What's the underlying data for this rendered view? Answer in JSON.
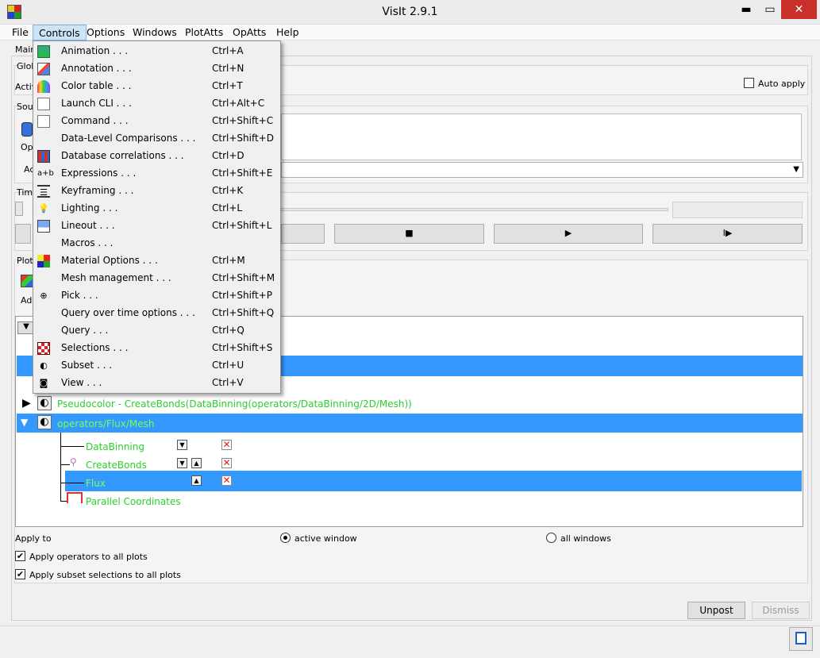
{
  "window": {
    "title": "VisIt 2.9.1",
    "minimize": "▬",
    "maximize": "▭",
    "close": "✕"
  },
  "menubar": [
    "File",
    "Controls",
    "Options",
    "Windows",
    "PlotAtts",
    "OpAtts",
    "Help"
  ],
  "tabs": {
    "main": "Main"
  },
  "partial_labels": {
    "global": "Glob",
    "active": "Activ",
    "sources": "Sour",
    "open": "Op",
    "activate": "Ac",
    "time": "Time",
    "plots": "Plots",
    "add": "Add"
  },
  "auto_apply": "Auto apply",
  "vcr": {
    "stop": "■",
    "play": "▶",
    "step_forward": "I▶"
  },
  "plot_list": {
    "rows": [
      {
        "label": "Pseudocolor - CreateBonds(DataBinning(operators/DataBinning/2D/Mesh))"
      },
      {
        "label": "operators/Flux/Mesh"
      }
    ],
    "operators": [
      "DataBinning",
      "CreateBonds",
      "Flux",
      "Parallel Coordinates"
    ]
  },
  "apply_to": {
    "label": "Apply to",
    "active_window": "active window",
    "all_windows": "all windows"
  },
  "options": {
    "apply_operators": "Apply operators to all plots",
    "apply_subset": "Apply subset selections to all plots"
  },
  "buttons": {
    "unpost": "Unpost",
    "dismiss": "Dismiss"
  },
  "controls_menu": [
    {
      "label": "Animation . . .",
      "shortcut": "Ctrl+A",
      "icon": "animation-icon"
    },
    {
      "label": "Annotation . . .",
      "shortcut": "Ctrl+N",
      "icon": "annotation-icon"
    },
    {
      "label": "Color table . . .",
      "shortcut": "Ctrl+T",
      "icon": "color-table-icon"
    },
    {
      "label": "Launch CLI . . .",
      "shortcut": "Ctrl+Alt+C",
      "icon": "cli-icon"
    },
    {
      "label": "Command . . .",
      "shortcut": "Ctrl+Shift+C",
      "icon": "command-icon"
    },
    {
      "label": "Data-Level Comparisons . . .",
      "shortcut": "Ctrl+Shift+D",
      "icon": ""
    },
    {
      "label": "Database correlations . . .",
      "shortcut": "Ctrl+D",
      "icon": "database-correlation-icon"
    },
    {
      "label": "Expressions . . .",
      "shortcut": "Ctrl+Shift+E",
      "icon": "expressions-icon",
      "icon_text": "a+b"
    },
    {
      "label": "Keyframing . . .",
      "shortcut": "Ctrl+K",
      "icon": "keyframing-icon"
    },
    {
      "label": "Lighting . . .",
      "shortcut": "Ctrl+L",
      "icon": "lightbulb-icon"
    },
    {
      "label": "Lineout . . .",
      "shortcut": "Ctrl+Shift+L",
      "icon": "lineout-icon"
    },
    {
      "label": "Macros . . .",
      "shortcut": "",
      "icon": ""
    },
    {
      "label": "Material Options . . .",
      "shortcut": "Ctrl+M",
      "icon": "material-icon"
    },
    {
      "label": "Mesh management . . .",
      "shortcut": "Ctrl+Shift+M",
      "icon": ""
    },
    {
      "label": "Pick . . .",
      "shortcut": "Ctrl+Shift+P",
      "icon": "crosshair-icon"
    },
    {
      "label": "Query over time options . . .",
      "shortcut": "Ctrl+Shift+Q",
      "icon": ""
    },
    {
      "label": "Query . . .",
      "shortcut": "Ctrl+Q",
      "icon": ""
    },
    {
      "label": "Selections . . .",
      "shortcut": "Ctrl+Shift+S",
      "icon": "selections-icon"
    },
    {
      "label": "Subset . . .",
      "shortcut": "Ctrl+U",
      "icon": "subset-icon"
    },
    {
      "label": "View . . .",
      "shortcut": "Ctrl+V",
      "icon": "view-camera-icon"
    }
  ]
}
